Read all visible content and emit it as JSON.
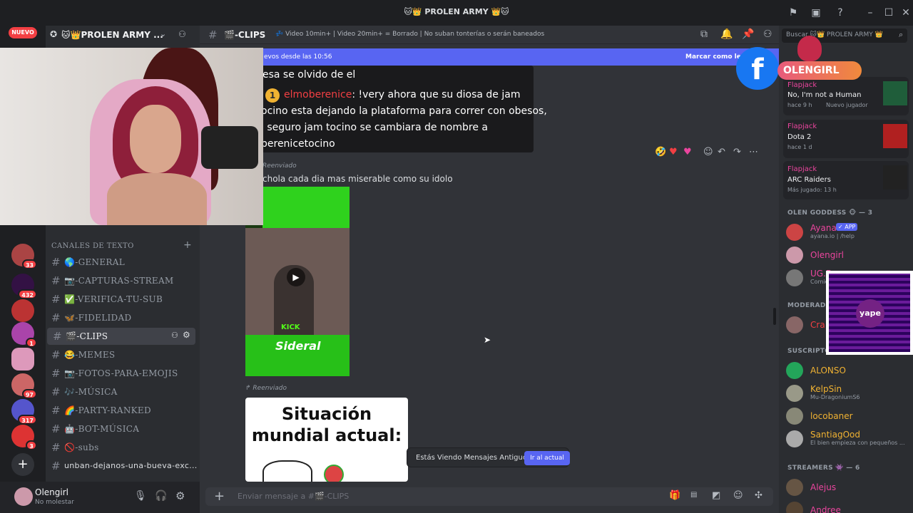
{
  "window": {
    "title": "🐱👑 PROLEN ARMY 👑🐱"
  },
  "rail": {
    "new_label": "NUEVO",
    "badges": [
      "33",
      "432",
      "1",
      "97",
      "317",
      "3"
    ]
  },
  "server": {
    "name": "🐱👑PROLEN ARMY ...",
    "category": "CANALES DE TEXTO",
    "channels": [
      "🌎-GENERAL",
      "📷-CAPTURAS-STREAM",
      "✅-VERIFICA-TU-SUB",
      "🦋-FIDELIDAD",
      "🎬-CLIPS",
      "😂-MEMES",
      "📷-FOTOS-PARA-EMOJIS",
      "🎶-MÚSICA",
      "🌈-PARTY-RANKED",
      "🤖-BOT-MÚSICA",
      "🚫-subs",
      "unban-dejanos-una-bueva-exc..."
    ]
  },
  "user": {
    "name": "Olengirl",
    "status": "No molestar"
  },
  "header": {
    "channel": "🎬-CLIPS",
    "topic": "💤 Video 10min+ | Video 20min+ = Borrado | No suban tonterías o serán baneados",
    "search_placeholder": "Buscar 🐱👑 PROLEN ARMY 👑"
  },
  "banner": {
    "text": "evos desde las 10:56",
    "action": "Marcar como leído"
  },
  "messages": {
    "first_line": "esa se olvido de el",
    "level": "1",
    "author": "elmoberenice",
    "body": [
      ": !very ahora que su diosa de jam",
      "ocino esta dejando la plataforma para correr con obesos,",
      "l seguro jam tocino se cambiara de nombre a",
      "berenicetocino"
    ],
    "forwarded1": "Reenviado",
    "reply_text": "chola cada dia mas miserable como su idolo",
    "forwarded2": "Reenviado",
    "video_caption1": "Sideral",
    "video_caption2": "KICK",
    "meme_title": "Situación mundial actual:"
  },
  "composer": {
    "placeholder": "Enviar mensaje a #🎬-CLIPS"
  },
  "jump": {
    "text": "Estás Viendo Mensajes Antiguos",
    "button": "Ir al actual"
  },
  "overlay": {
    "fb_name": "OLENGIRL",
    "qr_label": "yape"
  },
  "activity": [
    {
      "user": "Flapjack",
      "game": "No, I'm not a Human",
      "meta": "hace 9 h",
      "meta2": "Nuevo jugador"
    },
    {
      "user": "Flapjack",
      "game": "Dota 2",
      "meta": "hace 1 d"
    },
    {
      "user": "Flapjack",
      "game": "ARC Raiders",
      "meta": "Más jugado: 13 h"
    }
  ],
  "groups": {
    "owners": "OLEN GODDESS 🐵 — 3",
    "mods": "MODERADO",
    "subs": "SUSCRIPTO",
    "streamers": "STREAMERS 👾 — 6"
  },
  "members": {
    "ayana": {
      "name": "Ayana",
      "tag": "✓ APP",
      "status": "ayana.io | /help"
    },
    "olengirl": {
      "name": "Olengirl"
    },
    "ug": {
      "name": "UG.B",
      "status": "Comie"
    },
    "cra": {
      "name": "Cra"
    },
    "alonso": {
      "name": "ALONSO"
    },
    "kelp": {
      "name": "KelpSin",
      "status": "Mu-DragoniumS6"
    },
    "loco": {
      "name": "locobaner"
    },
    "santiago": {
      "name": "SantiagOod",
      "status": "El bien empieza con pequeños ..."
    },
    "alejus": {
      "name": "Alejus"
    },
    "andree": {
      "name": "Andree"
    }
  },
  "colors": {
    "accent": "#5865f2",
    "red": "#f23f43",
    "pink": "#eb459e",
    "gold": "#f0b232",
    "green": "#23a55a"
  }
}
